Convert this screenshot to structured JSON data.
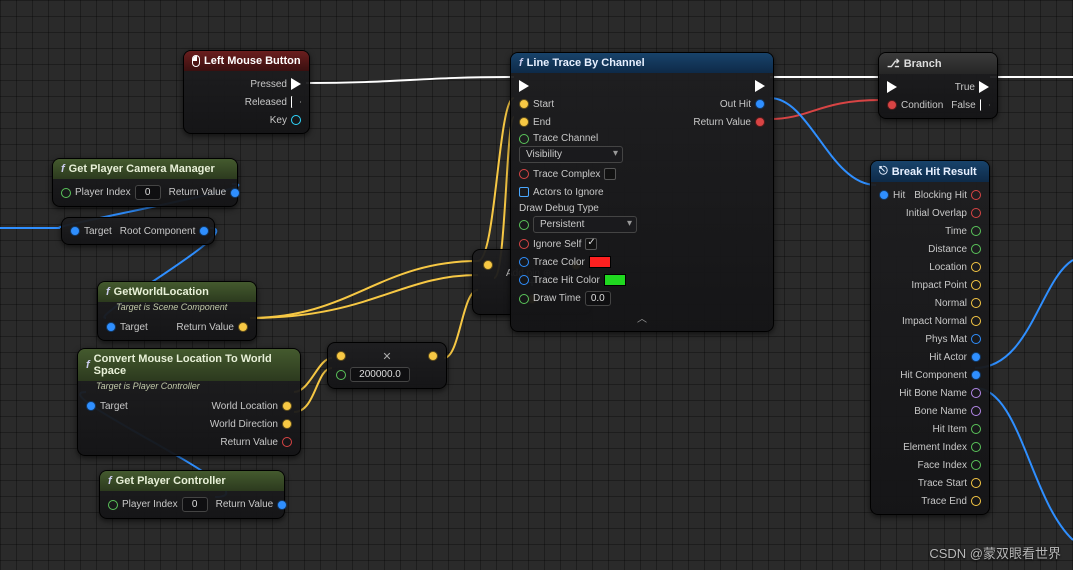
{
  "nodes": {
    "lmb": {
      "title": "Left Mouse Button",
      "pins": {
        "pressed": "Pressed",
        "released": "Released",
        "key": "Key"
      }
    },
    "camMgr": {
      "title": "Get Player Camera Manager",
      "pins": {
        "playerIndex": "Player Index",
        "playerIndexVal": "0",
        "return": "Return Value"
      }
    },
    "rootComp": {
      "pins": {
        "target": "Target",
        "rootComp": "Root Component"
      }
    },
    "worldLoc": {
      "title": "GetWorldLocation",
      "sub": "Target is Scene Component",
      "pins": {
        "target": "Target",
        "return": "Return Value"
      }
    },
    "mouseWorld": {
      "title": "Convert Mouse Location To World Space",
      "sub": "Target is Player Controller",
      "pins": {
        "target": "Target",
        "worldLoc": "World Location",
        "worldDir": "World Direction",
        "return": "Return Value"
      }
    },
    "getPC": {
      "title": "Get Player Controller",
      "pins": {
        "playerIndex": "Player Index",
        "playerIndexVal": "0",
        "return": "Return Value"
      }
    },
    "mult": {
      "value": "200000.0"
    },
    "add": {
      "label": "Add pin",
      "plus": "+"
    },
    "lineTrace": {
      "title": "Line Trace By Channel",
      "pins": {
        "start": "Start",
        "end": "End",
        "traceChannelLabel": "Trace Channel",
        "traceChannelVal": "Visibility",
        "traceComplex": "Trace Complex",
        "actorsIgnore": "Actors to Ignore",
        "drawDebugLabel": "Draw Debug Type",
        "drawDebugVal": "Persistent",
        "ignoreSelf": "Ignore Self",
        "traceColor": "Trace Color",
        "traceHitColor": "Trace Hit Color",
        "drawTime": "Draw Time",
        "drawTimeVal": "0.0",
        "outHit": "Out Hit",
        "returnVal": "Return Value"
      }
    },
    "branch": {
      "title": "Branch",
      "pins": {
        "condition": "Condition",
        "true": "True",
        "false": "False"
      }
    },
    "breakHit": {
      "title": "Break Hit Result",
      "pins": {
        "hit": "Hit",
        "blockingHit": "Blocking Hit",
        "initialOverlap": "Initial Overlap",
        "time": "Time",
        "distance": "Distance",
        "location": "Location",
        "impactPoint": "Impact Point",
        "normal": "Normal",
        "impactNormal": "Impact Normal",
        "physMat": "Phys Mat",
        "hitActor": "Hit Actor",
        "hitComponent": "Hit Component",
        "hitBoneName": "Hit Bone Name",
        "boneName": "Bone Name",
        "hitItem": "Hit Item",
        "elementIndex": "Element Index",
        "faceIndex": "Face Index",
        "traceStart": "Trace Start",
        "traceEnd": "Trace End"
      }
    }
  },
  "colors": {
    "traceColor": "#ff2020",
    "traceHitColor": "#20d820"
  },
  "watermark": "CSDN @蒙双眼看世界"
}
